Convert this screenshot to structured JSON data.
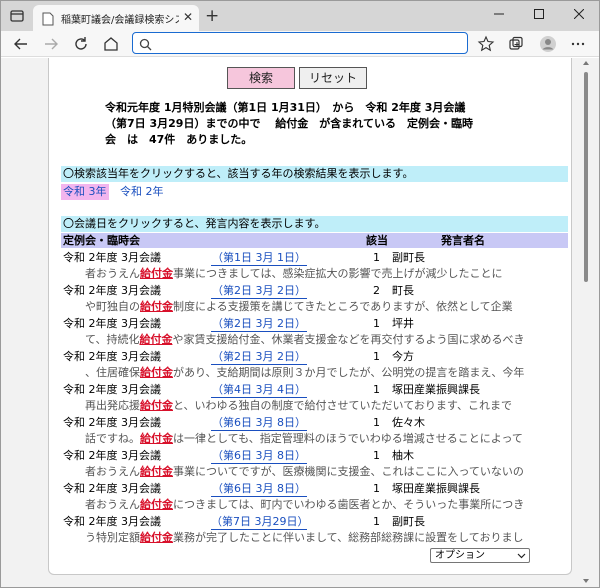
{
  "browser": {
    "tab_title": "稲葉町議会/会議録検索システム",
    "tab_close": "✕",
    "new_tab": "+",
    "address": ""
  },
  "buttons": {
    "search": "検索",
    "reset": "リセット"
  },
  "summary_lines": [
    "令和元年度 1月特別会議（第1日 1月31日）　から　令和 2年度 3月会議",
    "（第7日 3月29日）までの中で　 給付金　が含まれている　定例会・臨時",
    "会　は　47件　ありました。"
  ],
  "year_info": "〇検索該当年をクリックすると、該当する年の検索結果を表示します。",
  "years": {
    "selected": "令和 3年",
    "other": "令和 2年"
  },
  "meeting_info": "〇会議日をクリックすると、発言内容を表示します。",
  "table": {
    "headers": {
      "meeting": "定例会・臨時会",
      "count": "該当",
      "speaker": "発言者名"
    },
    "rows": [
      {
        "meeting": "令和 2年度 3月会議",
        "date": "（第1日 3月 1日）",
        "count": "1",
        "speaker": "副町長",
        "pre": "者おうえん",
        "kw": "給付金",
        "post": "事業につきましては、感染症拡大の影響で売上げが減少したことに"
      },
      {
        "meeting": "令和 2年度 3月会議",
        "date": "（第2日 3月 2日）",
        "count": "2",
        "speaker": "町長",
        "pre": "や町独自の",
        "kw": "給付金",
        "post": "制度による支援策を講じてきたところでありますが、依然として企業"
      },
      {
        "meeting": "令和 2年度 3月会議",
        "date": "（第2日 3月 2日）",
        "count": "1",
        "speaker": "坪井",
        "pre": "て、持続化",
        "kw": "給付金",
        "post": "や家賃支援給付金、休業者支援金などを再交付するよう国に求めるべき"
      },
      {
        "meeting": "令和 2年度 3月会議",
        "date": "（第2日 3月 2日）",
        "count": "1",
        "speaker": "今方",
        "pre": "、住居確保",
        "kw": "給付金",
        "post": "があり、支給期間は原則３か月でしたが、公明党の提言を踏まえ、今年"
      },
      {
        "meeting": "令和 2年度 3月会議",
        "date": "（第4日 3月 4日）",
        "count": "1",
        "speaker": "塚田産業振興課長",
        "pre": "再出発応援",
        "kw": "給付金",
        "post": "と、いわゆる独自の制度で給付させていただいております、これまで"
      },
      {
        "meeting": "令和 2年度 3月会議",
        "date": "（第6日 3月 8日）",
        "count": "1",
        "speaker": "佐々木",
        "pre": "話ですね。",
        "kw": "給付金",
        "post": "は一律としても、指定管理料のほうでいわゆる増減させることによって"
      },
      {
        "meeting": "令和 2年度 3月会議",
        "date": "（第6日 3月 8日）",
        "count": "1",
        "speaker": "柚木",
        "pre": "者おうえん",
        "kw": "給付金",
        "post": "事業についてですが、医療機関に支援金、これはここに入っていないの"
      },
      {
        "meeting": "令和 2年度 3月会議",
        "date": "（第6日 3月 8日）",
        "count": "1",
        "speaker": "塚田産業振興課長",
        "pre": "者おうえん",
        "kw": "給付金",
        "post": "につきましては、町内でいわゆる歯医者とか、そういった事業所につき"
      },
      {
        "meeting": "令和 2年度 3月会議",
        "date": "（第7日 3月29日）",
        "count": "1",
        "speaker": "副町長",
        "pre": "う特別定額",
        "kw": "給付金",
        "post": "業務が完了したことに伴いまして、総務部総務課に設置をしておりまし"
      }
    ]
  },
  "option_select": "オプション"
}
